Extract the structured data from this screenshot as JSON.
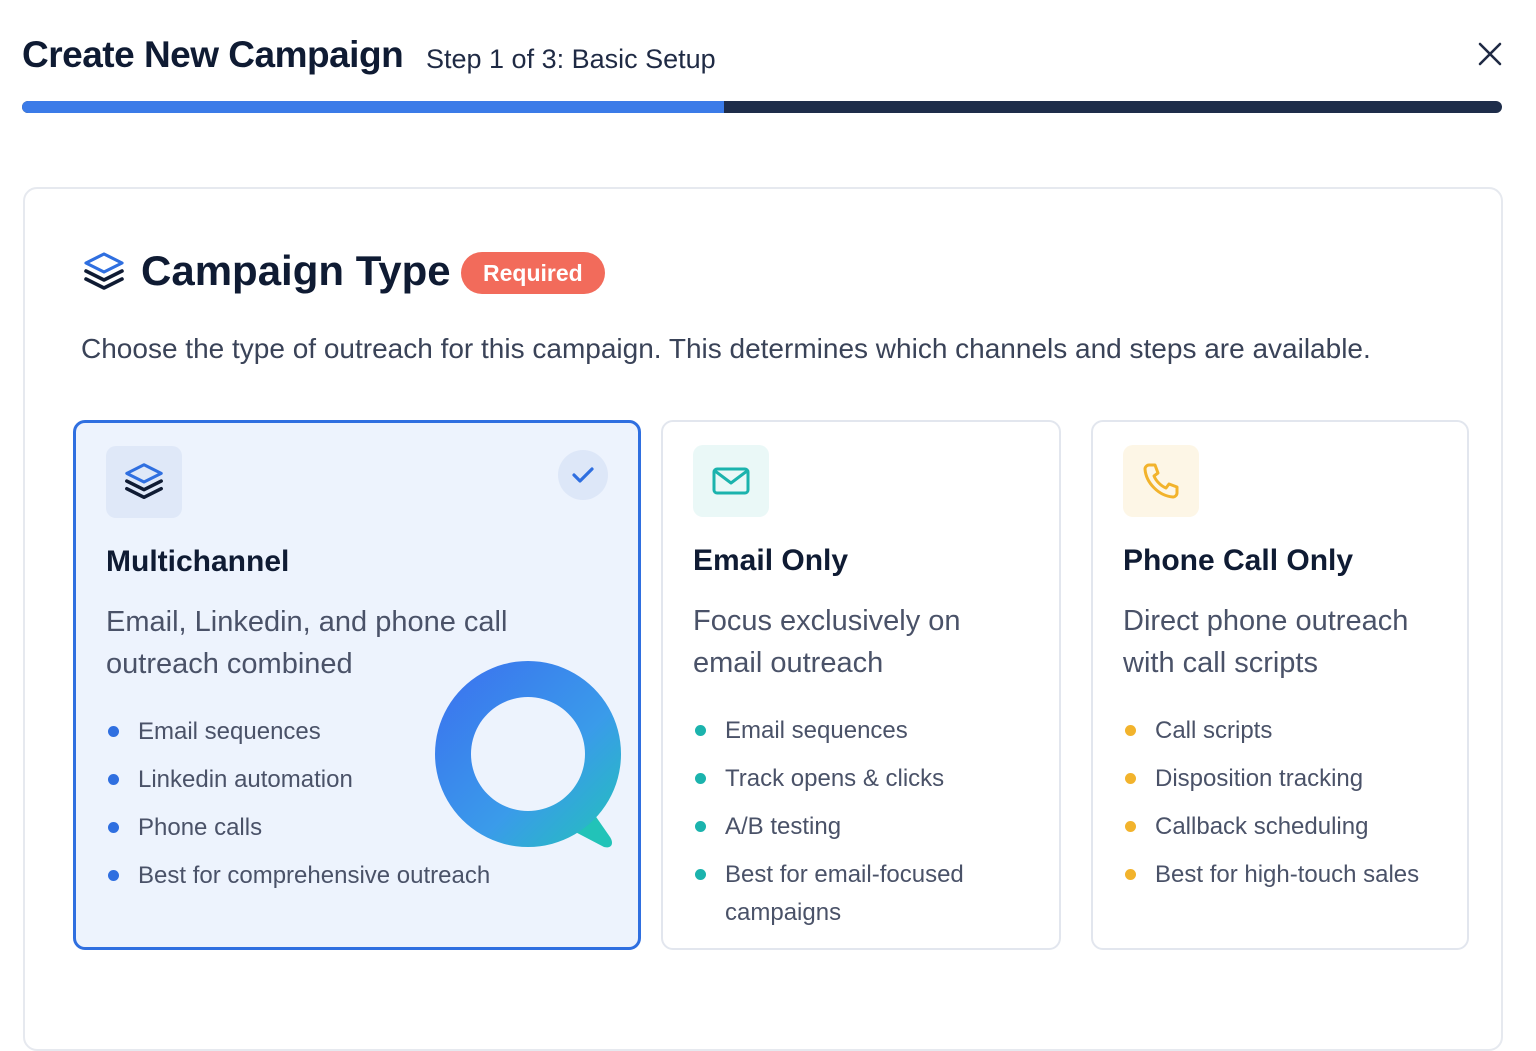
{
  "header": {
    "title": "Create New Campaign",
    "step": "Step 1 of 3: Basic Setup",
    "close_icon": "close-icon",
    "progress": 0.474
  },
  "section": {
    "icon": "layers-icon",
    "title": "Campaign Type",
    "badge": "Required",
    "description": "Choose the type of outreach for this campaign. This determines which channels and steps are available."
  },
  "cards": [
    {
      "name": "Multichannel",
      "description": "Email, Linkedin, and phone call outreach combined",
      "icon": "layers-icon",
      "selected": true,
      "accent": "#2f6fe0",
      "features": [
        "Email sequences",
        "Linkedin automation",
        "Phone calls",
        "Best for comprehensive outreach"
      ]
    },
    {
      "name": "Email Only",
      "description": "Focus exclusively on email outreach",
      "icon": "mail-icon",
      "selected": false,
      "accent": "#1bb3ad",
      "features": [
        "Email sequences",
        "Track opens & clicks",
        "A/B testing",
        "Best for email-focused campaigns"
      ]
    },
    {
      "name": "Phone Call Only",
      "description": "Direct phone outreach with call scripts",
      "icon": "phone-icon",
      "selected": false,
      "accent": "#f2b32c",
      "features": [
        "Call scripts",
        "Disposition tracking",
        "Callback scheduling",
        "Best for high-touch sales"
      ]
    }
  ],
  "colors": {
    "primary": "#3b7be8",
    "progress_track": "#1e2d4a",
    "badge": "#f26b5b",
    "text_dark": "#0f1b33"
  }
}
